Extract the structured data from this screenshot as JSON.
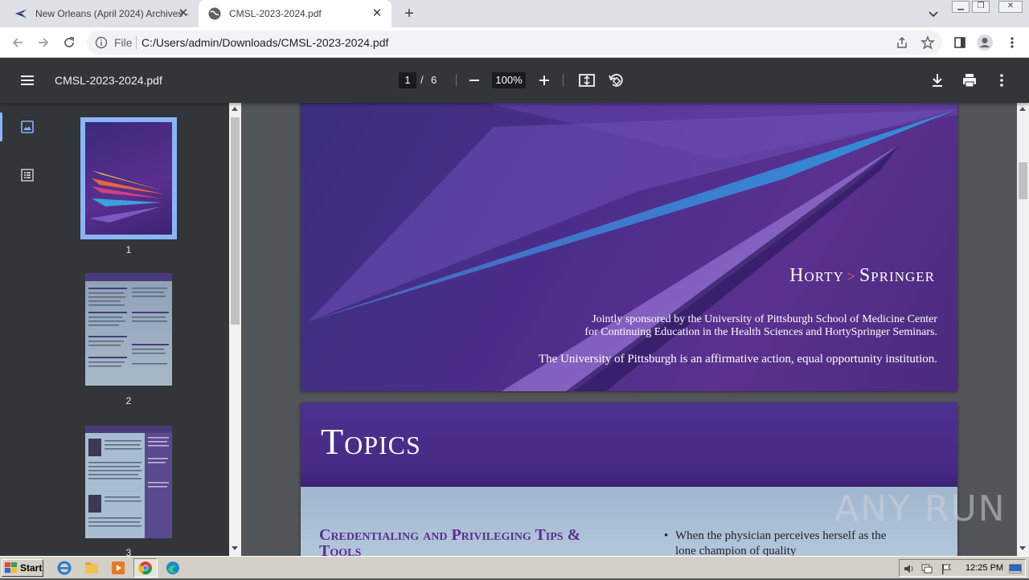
{
  "browser": {
    "tabs": [
      {
        "title": "New Orleans (April 2024) Archives - ",
        "active": false
      },
      {
        "title": "CMSL-2023-2024.pdf",
        "active": true
      }
    ],
    "omnibox": {
      "scheme_label": "File",
      "url": "C:/Users/admin/Downloads/CMSL-2023-2024.pdf"
    }
  },
  "pdf_toolbar": {
    "title": "CMSL-2023-2024.pdf",
    "current_page": "1",
    "separator": "/",
    "total_pages": "6",
    "zoom": "100%"
  },
  "sidebar": {
    "thumbnails": [
      {
        "label": "1",
        "selected": true
      },
      {
        "label": "2",
        "selected": false
      },
      {
        "label": "3",
        "selected": false
      }
    ]
  },
  "page1": {
    "brand_left": "Horty",
    "brand_right": "Springer",
    "sponsor_line1": "Jointly sponsored by the University of Pittsburgh School of Medicine Center",
    "sponsor_line2": "for Continuing Education in the Health Sciences and HortySpringer Seminars.",
    "equal_opportunity": "The University of Pittsburgh is an affirmative action, equal opportunity institution."
  },
  "page2": {
    "title": "Topics",
    "section_title": "Credentialing and Privileging Tips & Tools",
    "bullet": "When the physician perceives herself as the lone champion of quality"
  },
  "watermark": "ANY RUN",
  "taskbar": {
    "start_label": "Start",
    "clock": "12:25 PM"
  },
  "colors": {
    "pdf_toolbar_bg": "#323639",
    "viewer_bg": "#525659",
    "cover_purple": "#4a2d8a",
    "accent_blue": "#8ab4f8",
    "section_title_purple": "#5b2f8c"
  }
}
